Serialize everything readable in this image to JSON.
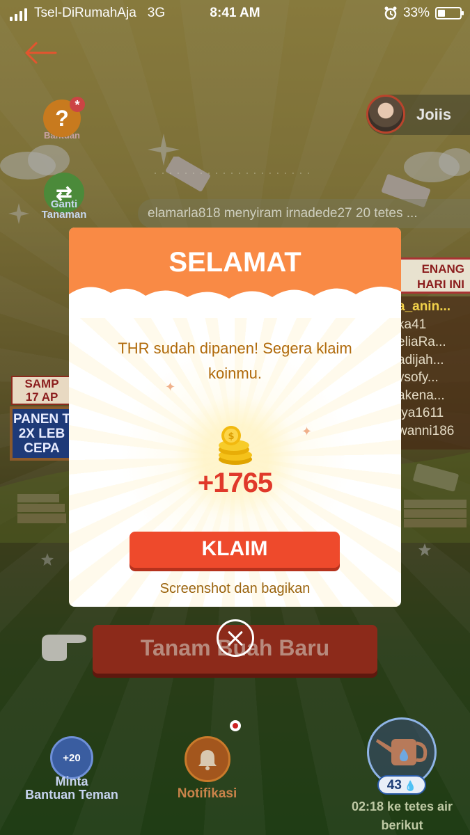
{
  "status_bar": {
    "carrier": "Tsel-DiRumahAja",
    "network": "3G",
    "time": "8:41 AM",
    "battery_percent": "33%",
    "battery_level": 0.33
  },
  "game": {
    "help_label": "Bantuan",
    "change_plant_label": "Ganti Tanaman",
    "profile_name": "Joiis",
    "ticker_text": "elamarla818 menyiram irnadede27 20 tetes ...",
    "leaderboard": {
      "title_line1": "ENANG",
      "title_line2": "HARI INI",
      "entries": [
        "a_anin...",
        "ka41",
        "eliaRa...",
        "adijah...",
        "ysofy...",
        "akena...",
        "tya1611",
        "wanni186"
      ]
    },
    "promo": {
      "top_line1": "SAMP",
      "top_line2": "17 AP",
      "body_line1": "PANEN T",
      "body_line2": "2X LEB",
      "body_line3": "CEPA"
    },
    "plant_button_label": "Tanam Buah Baru",
    "ask_help": {
      "badge": "+20",
      "label_line1": "Minta",
      "label_line2": "Bantuan Teman"
    },
    "notifications_label": "Notifikasi",
    "water_count": "43",
    "water_timer_line1": "02:18 ke tetes air",
    "water_timer_line2": "berikut"
  },
  "modal": {
    "title": "SELAMAT",
    "message": "THR sudah dipanen! Segera klaim koinmu.",
    "amount": "+1765",
    "claim_label": "KLAIM",
    "share_label": "Screenshot dan bagikan"
  },
  "colors": {
    "header_orange": "#f98a45",
    "claim_red": "#ee4a2c",
    "amount_red": "#e0392a",
    "message_brown": "#b06a0b"
  }
}
